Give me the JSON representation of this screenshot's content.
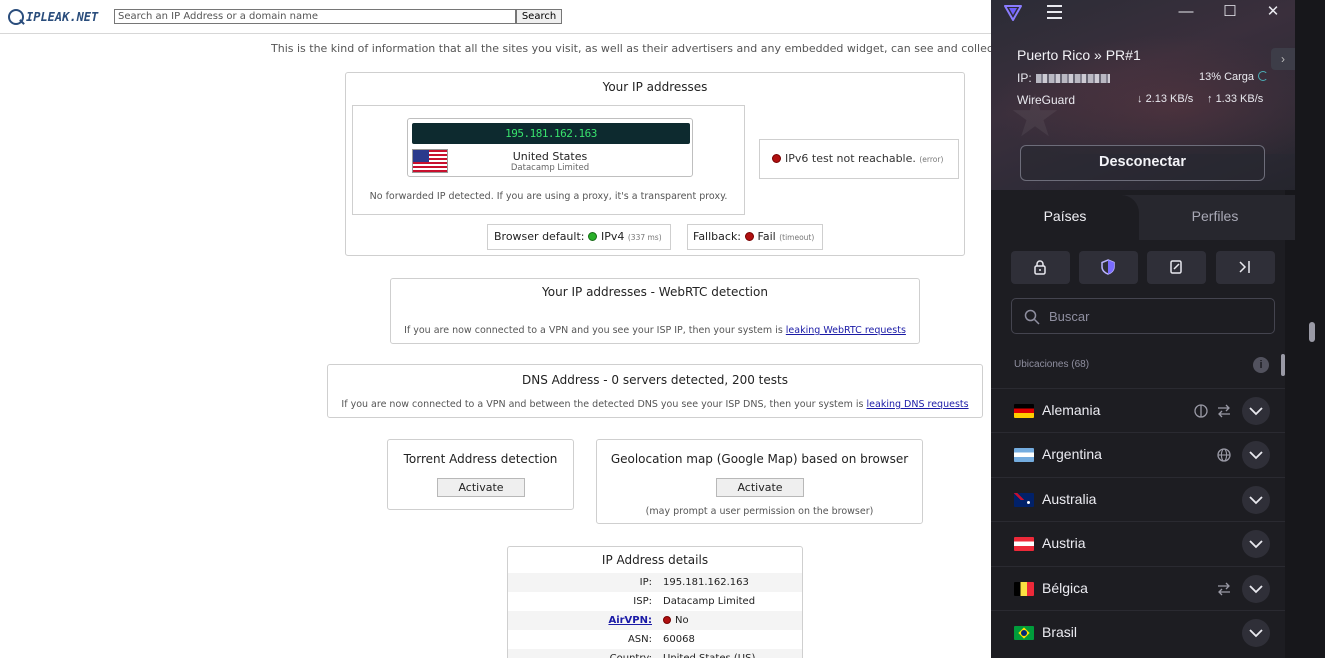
{
  "site": {
    "logo_text": "IPLEAK.NET",
    "search_placeholder": "Search an IP Address or a domain name",
    "search_button": "Search",
    "intro": "This is the kind of information that all the sites you visit, as well as their advertisers and any embedded widget, can see and collect about you."
  },
  "ip_section": {
    "title": "Your IP addresses",
    "ip": "195.181.162.163",
    "country": "United States",
    "isp": "Datacamp Limited",
    "no_forward": "No forwarded IP detected. If you are using a proxy, it's a transparent proxy.",
    "ipv6_text": "IPv6 test not reachable.",
    "ipv6_note": "(error)",
    "browser_default_label": "Browser default:",
    "browser_default_value": "IPv4",
    "browser_default_ms": "(337 ms)",
    "fallback_label": "Fallback:",
    "fallback_value": "Fail",
    "fallback_note": "(timeout)"
  },
  "webrtc": {
    "title": "Your IP addresses - WebRTC detection",
    "text": "If you are now connected to a VPN and you see your ISP IP, then your system is",
    "link": "leaking WebRTC requests"
  },
  "dns": {
    "title": "DNS Address - 0 servers detected, 200 tests",
    "text": "If you are now connected to a VPN and between the detected DNS you see your ISP DNS, then your system is",
    "link": "leaking DNS requests"
  },
  "torrent": {
    "title": "Torrent Address detection",
    "button": "Activate"
  },
  "geo": {
    "title": "Geolocation map (Google Map) based on browser",
    "button": "Activate",
    "note": "(may prompt a user permission on the browser)"
  },
  "details": {
    "title": "IP Address details",
    "rows": [
      {
        "label": "IP:",
        "value": "195.181.162.163"
      },
      {
        "label": "ISP:",
        "value": "Datacamp Limited"
      },
      {
        "label": "AirVPN:",
        "value": "No"
      },
      {
        "label": "ASN:",
        "value": "60068"
      },
      {
        "label": "Country:",
        "value": "United States (US)"
      }
    ]
  },
  "vpn": {
    "server": "Puerto Rico » PR#1",
    "ip_label": "IP:",
    "load": "13% Carga",
    "protocol": "WireGuard",
    "down": "2.13 KB/s",
    "up": "1.33 KB/s",
    "disconnect": "Desconectar",
    "tab_countries": "Países",
    "tab_profiles": "Perfiles",
    "search_placeholder": "Buscar",
    "locations": "Ubicaciones (68)",
    "countries": [
      {
        "name": "Alemania",
        "features": [
          "tor-icon",
          "p2p-icon"
        ]
      },
      {
        "name": "Argentina",
        "features": [
          "globe-icon"
        ]
      },
      {
        "name": "Australia",
        "features": []
      },
      {
        "name": "Austria",
        "features": []
      },
      {
        "name": "Bélgica",
        "features": [
          "p2p-icon"
        ]
      },
      {
        "name": "Brasil",
        "features": []
      }
    ]
  },
  "colors": {
    "ip_strip_bg": "#0d2a2f",
    "ip_strip_text": "#39e26d",
    "vpn_bg": "#1d1d22",
    "link": "#1a1aa6"
  }
}
